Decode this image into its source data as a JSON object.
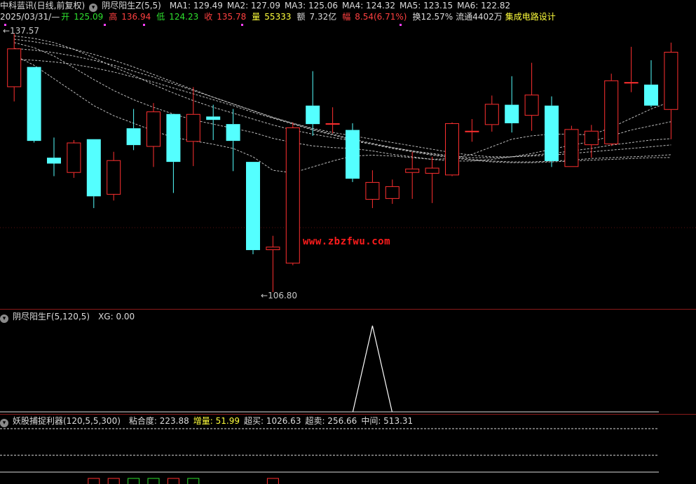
{
  "colors": {
    "up": "#ff3030",
    "down": "#54ffff",
    "ma": "#dcdcdc",
    "separator": "#8b1a1a",
    "background": "#000000"
  },
  "header": {
    "stock": "中科蓝讯(日线,前复权)",
    "indicator": "阴尽阳生Z(5,5)",
    "ma": [
      "MA1: 129.49",
      "MA2: 127.09",
      "MA3: 125.06",
      "MA4: 124.32",
      "MA5: 123.15",
      "MA6: 122.82"
    ]
  },
  "quote": {
    "date": "2025/03/31/—",
    "open_label": "开",
    "open": "125.09",
    "high_label": "高",
    "high": "136.94",
    "low_label": "低",
    "low": "124.23",
    "close_label": "收",
    "close": "135.78",
    "volume_label": "量",
    "volume": "55333",
    "amount_label": "额",
    "amount": "7.32亿",
    "change_label": "幅",
    "change": "8.54(6.71%)",
    "turnover": "换12.57%",
    "float": "流通4402万",
    "sector": "集成电路设计"
  },
  "annotations": {
    "max_price": "137.57",
    "min_price": "106.80"
  },
  "watermark": "www.zbzfwu.com",
  "indicator2": {
    "title": "阴尽阳生F(5,120,5)",
    "xg": "XG: 0.00"
  },
  "indicator3": {
    "title": "妖股捕捉利器(120,5,5,300)",
    "stickiness": "粘合度: 223.88",
    "increase": "增量: 51.99",
    "overbought": "超买: 1026.63",
    "oversold": "超卖: 256.66",
    "middle": "中间: 513.31"
  },
  "chart_data": {
    "type": "candlestick",
    "price_range": [
      106.8,
      137.57
    ],
    "candles": [
      {
        "o": 131.2,
        "c": 135.8,
        "h": 137.57,
        "l": 129.5
      },
      {
        "o": 133.6,
        "c": 124.8,
        "h": 133.6,
        "l": 124.6
      },
      {
        "o": 122.8,
        "c": 122.1,
        "h": 125.2,
        "l": 120.6
      },
      {
        "o": 121.0,
        "c": 124.6,
        "h": 124.9,
        "l": 120.4
      },
      {
        "o": 125.0,
        "c": 118.2,
        "h": 125.0,
        "l": 116.8
      },
      {
        "o": 118.4,
        "c": 122.5,
        "h": 123.5,
        "l": 117.7
      },
      {
        "o": 126.3,
        "c": 124.3,
        "h": 128.6,
        "l": 123.7
      },
      {
        "o": 124.1,
        "c": 128.3,
        "h": 129.3,
        "l": 121.7
      },
      {
        "o": 128.0,
        "c": 122.3,
        "h": 128.0,
        "l": 118.6
      },
      {
        "o": 124.7,
        "c": 128.0,
        "h": 131.2,
        "l": 121.8
      },
      {
        "o": 127.7,
        "c": 127.3,
        "h": 129.1,
        "l": 124.9
      },
      {
        "o": 126.8,
        "c": 124.8,
        "h": 128.6,
        "l": 121.2
      },
      {
        "o": 122.3,
        "c": 111.8,
        "h": 122.3,
        "l": 111.3
      },
      {
        "o": 111.8,
        "c": 112.2,
        "h": 113.5,
        "l": 106.8
      },
      {
        "o": 110.2,
        "c": 126.4,
        "h": 127.0,
        "l": 110.0
      },
      {
        "o": 129.0,
        "c": 126.8,
        "h": 133.1,
        "l": 125.4
      },
      {
        "o": 126.9,
        "c": 126.9,
        "h": 128.8,
        "l": 125.7
      },
      {
        "o": 126.1,
        "c": 120.3,
        "h": 126.9,
        "l": 119.9
      },
      {
        "o": 117.8,
        "c": 119.9,
        "h": 121.3,
        "l": 116.8
      },
      {
        "o": 117.9,
        "c": 119.4,
        "h": 120.2,
        "l": 117.3
      },
      {
        "o": 121.0,
        "c": 121.5,
        "h": 123.5,
        "l": 117.9
      },
      {
        "o": 120.9,
        "c": 121.6,
        "h": 122.9,
        "l": 117.4
      },
      {
        "o": 120.7,
        "c": 126.9,
        "h": 127.0,
        "l": 120.6
      },
      {
        "o": 125.9,
        "c": 126.0,
        "h": 127.4,
        "l": 124.7
      },
      {
        "o": 126.7,
        "c": 129.2,
        "h": 130.2,
        "l": 125.9
      },
      {
        "o": 129.1,
        "c": 126.9,
        "h": 132.5,
        "l": 125.8
      },
      {
        "o": 127.8,
        "c": 130.3,
        "h": 134.1,
        "l": 126.0
      },
      {
        "o": 129.0,
        "c": 122.4,
        "h": 130.1,
        "l": 121.7
      },
      {
        "o": 121.7,
        "c": 126.2,
        "h": 126.6,
        "l": 121.7
      },
      {
        "o": 124.3,
        "c": 126.0,
        "h": 126.7,
        "l": 122.8
      },
      {
        "o": 124.4,
        "c": 132.0,
        "h": 132.8,
        "l": 124.2
      },
      {
        "o": 131.8,
        "c": 131.8,
        "h": 136.0,
        "l": 130.6
      },
      {
        "o": 131.5,
        "c": 129.0,
        "h": 134.4,
        "l": 128.8
      },
      {
        "o": 128.5,
        "c": 135.4,
        "h": 136.5,
        "l": 125.0
      }
    ],
    "ma_series": [
      {
        "values": [
          135.0,
          133.8,
          132.2,
          130.6,
          129.0,
          127.8,
          126.9,
          126.0,
          125.2,
          124.8,
          124.4,
          123.9,
          122.9,
          121.3,
          121.0,
          121.7,
          122.4,
          123.0,
          123.1,
          123.0,
          122.8,
          122.6,
          122.7,
          123.2,
          124.1,
          125.0,
          125.4,
          125.6,
          125.6,
          125.5,
          126.4,
          127.5,
          128.6,
          129.49
        ]
      },
      {
        "values": [
          136.5,
          135.9,
          134.9,
          133.5,
          132.1,
          130.8,
          129.7,
          128.8,
          128.0,
          127.3,
          126.8,
          126.3,
          125.8,
          125.1,
          124.6,
          124.2,
          124.0,
          123.9,
          123.6,
          123.2,
          122.9,
          122.6,
          122.4,
          122.4,
          122.6,
          122.9,
          123.3,
          123.8,
          124.3,
          124.7,
          125.4,
          126.1,
          126.6,
          127.09
        ]
      },
      {
        "values": [
          137.3,
          137.0,
          136.5,
          135.7,
          134.7,
          133.6,
          132.6,
          131.5,
          130.5,
          129.6,
          128.8,
          128.1,
          127.4,
          126.7,
          126.1,
          125.6,
          125.2,
          124.8,
          124.4,
          124.0,
          123.6,
          123.3,
          123.0,
          122.8,
          122.8,
          122.9,
          123.1,
          123.3,
          123.6,
          123.9,
          124.3,
          124.6,
          124.9,
          125.06
        ]
      },
      {
        "values": [
          136.9,
          136.6,
          136.2,
          135.7,
          135.1,
          134.4,
          133.6,
          132.7,
          131.8,
          130.9,
          130.0,
          129.2,
          128.4,
          127.6,
          126.9,
          126.3,
          125.8,
          125.4,
          125.0,
          124.6,
          124.2,
          123.8,
          123.4,
          123.1,
          122.9,
          122.9,
          123.0,
          123.1,
          123.3,
          123.5,
          123.7,
          123.9,
          124.1,
          124.32
        ]
      },
      {
        "values": [
          135.8,
          135.6,
          135.3,
          134.9,
          134.4,
          133.8,
          133.1,
          132.4,
          131.6,
          130.8,
          130.0,
          129.2,
          128.4,
          127.6,
          126.9,
          126.2,
          125.6,
          125.0,
          124.5,
          124.0,
          123.6,
          123.2,
          122.9,
          122.6,
          122.4,
          122.3,
          122.3,
          122.4,
          122.5,
          122.7,
          122.8,
          122.9,
          123.0,
          123.15
        ]
      },
      {
        "values": [
          134.5,
          134.4,
          134.2,
          133.9,
          133.5,
          133.0,
          132.4,
          131.8,
          131.1,
          130.4,
          129.7,
          129.0,
          128.2,
          127.5,
          126.8,
          126.1,
          125.5,
          124.9,
          124.4,
          123.9,
          123.5,
          123.1,
          122.8,
          122.5,
          122.3,
          122.2,
          122.2,
          122.3,
          122.4,
          122.5,
          122.6,
          122.7,
          122.8,
          122.82
        ]
      }
    ],
    "xg_signal": [
      0,
      0,
      0,
      0,
      0,
      0,
      0,
      0,
      0,
      0,
      0,
      0,
      0,
      0,
      0,
      0,
      0,
      0,
      1,
      0,
      0,
      0,
      0,
      0,
      0,
      0,
      0,
      0,
      0,
      0,
      0,
      0,
      0,
      0
    ],
    "bottom_bars": [
      {
        "index": 4,
        "up": true
      },
      {
        "index": 5,
        "up": true
      },
      {
        "index": 6,
        "up": false
      },
      {
        "index": 7,
        "up": false
      },
      {
        "index": 8,
        "up": true
      },
      {
        "index": 9,
        "up": false
      },
      {
        "index": 13,
        "up": true
      }
    ]
  }
}
